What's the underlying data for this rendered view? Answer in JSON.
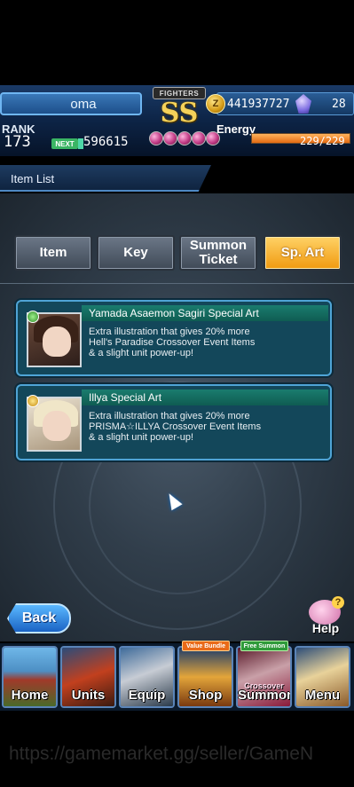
{
  "player": {
    "name": "oma",
    "rank_label": "RANK",
    "rank": "173",
    "next_label": "NEXT",
    "next_exp": "596615"
  },
  "emblem": {
    "team": "FIGHTERS",
    "grade": "SS"
  },
  "currency": {
    "zel": "441937727",
    "gems": "28"
  },
  "energy": {
    "label": "Energy",
    "value": "229/229",
    "fill_percent": 100
  },
  "page": {
    "title": "Item List"
  },
  "tabs": [
    {
      "label": "Item",
      "active": false
    },
    {
      "label": "Key",
      "active": false
    },
    {
      "label": "Summon Ticket",
      "active": false
    },
    {
      "label": "Sp. Art",
      "active": true
    }
  ],
  "items": [
    {
      "title": "Yamada Asaemon Sagiri Special Art",
      "desc_1": "Extra illustration that gives 20% more",
      "desc_2": "Hell's Paradise Crossover Event Items",
      "desc_3": "& a slight unit power-up!"
    },
    {
      "title": "Illya Special Art",
      "desc_1": "Extra illustration that gives 20% more",
      "desc_2": "PRISMA☆ILLYA Crossover Event Items",
      "desc_3": "& a slight unit power-up!"
    }
  ],
  "buttons": {
    "back": "Back",
    "help": "Help"
  },
  "nav": [
    {
      "label": "Home"
    },
    {
      "label": "Units"
    },
    {
      "label": "Equip"
    },
    {
      "label": "Shop",
      "tag": "Value Bundle"
    },
    {
      "label": "Summon",
      "tag": "Free Summon",
      "sub": "Crossover"
    },
    {
      "label": "Menu"
    }
  ],
  "watermark": "https://gamemarket.gg/seller/GameN",
  "colors": {
    "active_tab": "#f09a10",
    "accent_blue": "#4fa4d6",
    "energy": "#e36a12"
  }
}
